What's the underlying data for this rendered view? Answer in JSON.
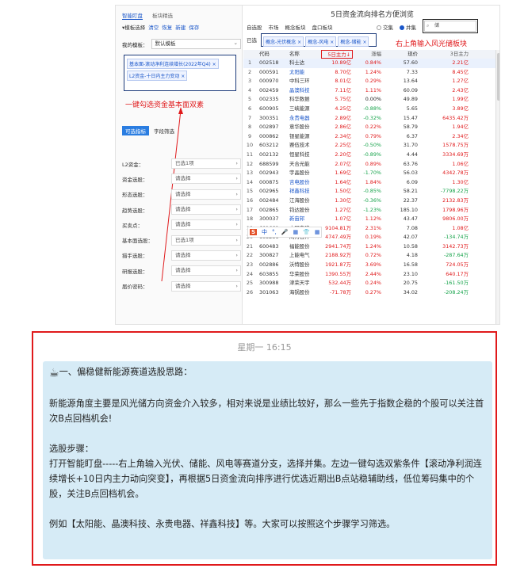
{
  "app": {
    "tabs": [
      "智能盯盘",
      "板块精选"
    ],
    "toolbar": {
      "model_label": "▾模板选择",
      "clear": "清空",
      "restore": "恢复",
      "new": "新建",
      "save": "保存"
    },
    "model": {
      "label": "我的模板：",
      "value": "默认模板"
    },
    "left_chips": [
      "基本面-滚动净利连续增长(2022年Q4) ×",
      "L2资金-十日内主力变动 ×"
    ],
    "annotation_left": "一键勾选资金基本面双素",
    "filter_buttons": [
      "可选指标",
      "字段筛选"
    ],
    "filters": [
      {
        "label": "L2资金：",
        "value": "已选1项"
      },
      {
        "label": "资金选股：",
        "value": "请选择"
      },
      {
        "label": "形态选股：",
        "value": "请选择"
      },
      {
        "label": "趋势选股：",
        "value": "请选择"
      },
      {
        "label": "买卖点：",
        "value": "请选择"
      },
      {
        "label": "基本面选股：",
        "value": "已选1项"
      },
      {
        "label": "猎手选股：",
        "value": "请选择"
      },
      {
        "label": "研报选股：",
        "value": "请选择"
      },
      {
        "label": "届价密码：",
        "value": "请选择"
      }
    ],
    "right_title": "5日资金流向排名方便浏览",
    "nav": [
      "自选股",
      "市场",
      "概念板块",
      "盘口板块"
    ],
    "radios": [
      {
        "label": "交集",
        "on": false
      },
      {
        "label": "并集",
        "on": true
      }
    ],
    "search": {
      "value": "储"
    },
    "sector_label": "已选",
    "right_chips": [
      "概念-光伏概念 ×",
      "概念-风电 ×",
      "概念-储能 ×"
    ],
    "annotation_right": "右上角输入风光储板块",
    "columns": [
      "",
      "代码",
      "名称",
      "5日主力↓",
      "涨幅",
      "现价",
      "3日主力"
    ],
    "rows": [
      [
        "1",
        "002518",
        "科士达",
        "10.89亿",
        "0.84%",
        "57.60",
        "2.21亿"
      ],
      [
        "2",
        "000591",
        "太阳能",
        "8.70亿",
        "1.24%",
        "7.33",
        "8.45亿"
      ],
      [
        "3",
        "000970",
        "中科三环",
        "8.01亿",
        "0.29%",
        "13.64",
        "1.27亿"
      ],
      [
        "4",
        "002459",
        "晶澳科技",
        "7.11亿",
        "1.11%",
        "60.09",
        "2.43亿"
      ],
      [
        "5",
        "002335",
        "科华数据",
        "5.75亿",
        "0.00%",
        "49.89",
        "1.99亿"
      ],
      [
        "6",
        "600905",
        "三峡能源",
        "4.25亿",
        "-0.88%",
        "5.65",
        "3.89亿"
      ],
      [
        "7",
        "300351",
        "永贵电器",
        "2.89亿",
        "-0.32%",
        "15.47",
        "6435.42万"
      ],
      [
        "8",
        "002897",
        "意华股份",
        "2.86亿",
        "0.22%",
        "58.79",
        "1.94亿"
      ],
      [
        "9",
        "000862",
        "银星能源",
        "2.34亿",
        "0.79%",
        "6.37",
        "2.34亿"
      ],
      [
        "10",
        "603212",
        "赛伍技术",
        "2.25亿",
        "-0.50%",
        "31.70",
        "1578.75万"
      ],
      [
        "11",
        "002132",
        "恒星科技",
        "2.20亿",
        "-0.89%",
        "4.44",
        "3334.69万"
      ],
      [
        "12",
        "688599",
        "天合光能",
        "2.07亿",
        "0.89%",
        "63.76",
        "1.06亿"
      ],
      [
        "13",
        "002943",
        "宇晶股份",
        "1.69亿",
        "-1.70%",
        "56.03",
        "4342.78万"
      ],
      [
        "14",
        "000875",
        "吉电股份",
        "1.64亿",
        "1.84%",
        "6.09",
        "1.30亿"
      ],
      [
        "15",
        "002965",
        "祥鑫科技",
        "1.50亿",
        "-0.85%",
        "58.21",
        "-7798.22万"
      ],
      [
        "16",
        "002484",
        "江海股份",
        "1.30亿",
        "-0.36%",
        "22.37",
        "2132.83万"
      ],
      [
        "17",
        "002865",
        "钧达股份",
        "1.27亿",
        "-1.23%",
        "185.10",
        "1798.96万"
      ],
      [
        "18",
        "300037",
        "新宙邦",
        "1.07亿",
        "1.12%",
        "43.47",
        "9806.00万"
      ],
      [
        "19",
        "601669",
        "中国电建",
        "9104.81万",
        "2.31%",
        "7.08",
        "1.08亿"
      ],
      [
        "20",
        "605286",
        "同力日升",
        "4747.49万",
        "0.19%",
        "42.07",
        "-134.74万"
      ],
      [
        "21",
        "600483",
        "福能股份",
        "2941.74万",
        "1.24%",
        "10.58",
        "3142.73万"
      ],
      [
        "22",
        "300827",
        "上能电气",
        "2188.92万",
        "0.72%",
        "4.18",
        "-287.64万"
      ],
      [
        "23",
        "002886",
        "沃特股份",
        "1921.87万",
        "3.69%",
        "16.58",
        "724.05万"
      ],
      [
        "24",
        "603855",
        "华荣股份",
        "1390.55万",
        "2.44%",
        "23.10",
        "640.17万"
      ],
      [
        "25",
        "300988",
        "津荣天宇",
        "532.44万",
        "0.24%",
        "20.75",
        "-161.50万"
      ],
      [
        "26",
        "301063",
        "海锅股份",
        "-71.78万",
        "0.27%",
        "34.02",
        "-208.24万"
      ]
    ],
    "blue_rows": [
      1,
      3,
      6,
      13,
      14,
      17
    ],
    "ime": {
      "logo": "S",
      "items": [
        "中",
        "°,",
        "🎤",
        "▦",
        "👕",
        "▦"
      ]
    }
  },
  "chat": {
    "timestamp": "星期一 16:15",
    "p1": "一、偏稳健新能源赛道选股思路：",
    "p2": "新能源角度主要是风光储方向资金介入较多，相对来说是业绩比较好，那么一些先于指数企稳的个股可以关注首次B点回档机会!",
    "p3": "选股步骤：\n打开智能盯盘-----右上角输入光伏、储能、风电等赛道分支，选择并集。左边一键勾选双紫条件【滚动净利润连续增长+10日内主力动向突变】，再根据5日资金流向排序进行优选近期出B点站稳辅助线，低位筹码集中的个股，关注B点回档机会。",
    "p4": "例如【太阳能、晶澳科技、永贵电器、祥鑫科技】等。大家可以按照这个步骤学习筛选。",
    "cup_icon": "☕"
  }
}
